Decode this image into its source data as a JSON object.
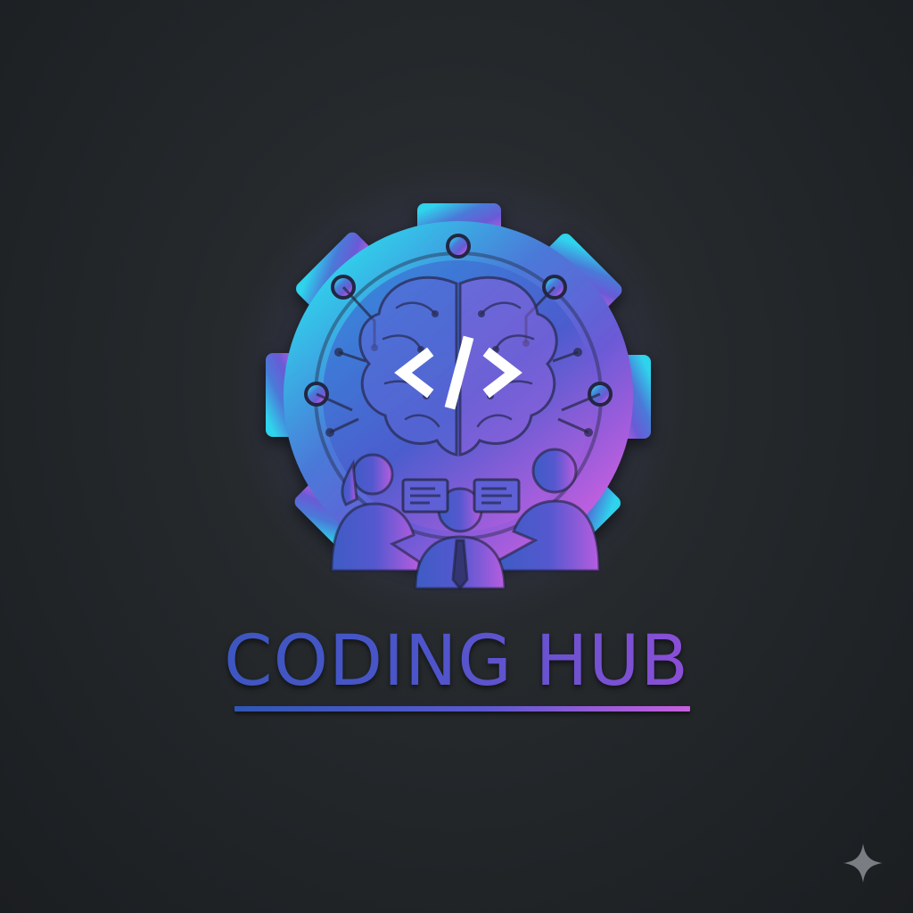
{
  "brand": {
    "name": "CODING HUB",
    "emblem_icon": "gear-brain-people-icon",
    "code_symbol": "</>"
  },
  "colors": {
    "background": "#25292c",
    "gradient_start": "#2fd3ec",
    "gradient_mid": "#4a55c9",
    "gradient_end": "#d05fe0",
    "code_symbol": "#ffffff"
  },
  "watermark": {
    "icon": "sparkle-icon"
  }
}
